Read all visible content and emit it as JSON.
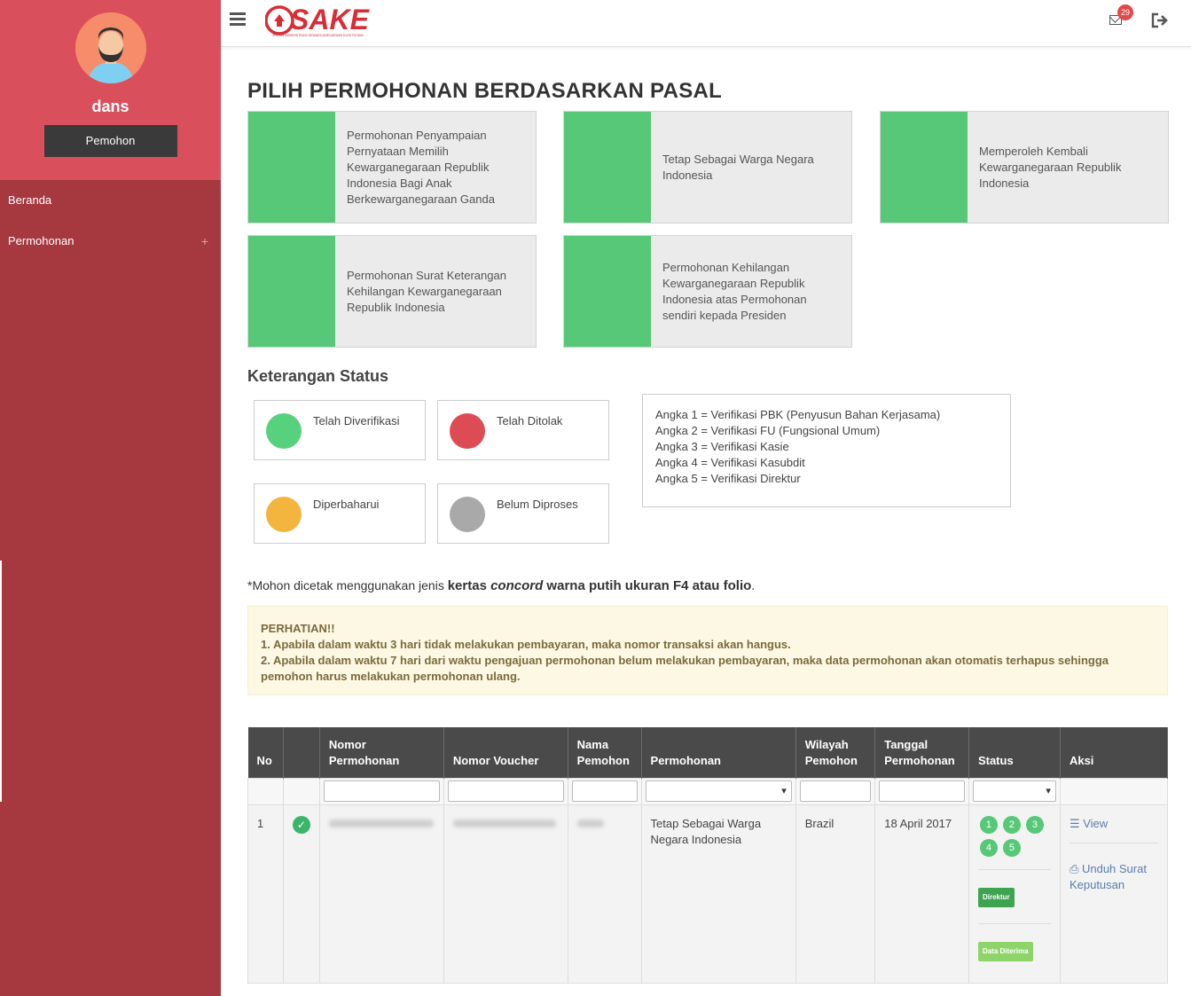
{
  "sidebar": {
    "username": "dans",
    "role": "Pemohon",
    "items": [
      {
        "label": "Beranda"
      },
      {
        "label": "Permohonan",
        "expand": "+"
      }
    ]
  },
  "topbar": {
    "logo_text": "SAKE",
    "logo_subtitle": "SISTEM ADMINISTRASI KEWARGANEGARAAN ELEKTRONIK",
    "notif_count": "29"
  },
  "main": {
    "title": "PILIH PERMOHONAN BERDASARKAN PASAL",
    "cards": [
      {
        "label": "Permohonan Penyampaian Pernyataan Memilih Kewarganegaraan Republik Indonesia Bagi Anak Berkewarganegaraan Ganda"
      },
      {
        "label": "Tetap Sebagai Warga Negara Indonesia"
      },
      {
        "label": "Memperoleh Kembali Kewarganegaraan Republik Indonesia"
      },
      {
        "label": "Permohonan Surat Keterangan Kehilangan Kewarganegaraan Republik Indonesia"
      },
      {
        "label": "Permohonan Kehilangan Kewarganegaraan Republik Indonesia atas Permohonan sendiri kepada Presiden"
      }
    ],
    "status_title": "Keterangan Status",
    "statuses": [
      {
        "label": "Telah Diverifikasi",
        "color": "#57d17e"
      },
      {
        "label": "Telah Ditolak",
        "color": "#dd4b55"
      },
      {
        "label": "Diperbaharui",
        "color": "#f4b53f"
      },
      {
        "label": "Belum Diproses",
        "color": "#a9a9a9"
      }
    ],
    "legend": [
      "Angka 1 = Verifikasi PBK (Penyusun Bahan Kerjasama)",
      "Angka 2 = Verifikasi FU (Fungsional Umum)",
      "Angka 3 = Verifikasi Kasie",
      "Angka 4 = Verifikasi Kasubdit",
      "Angka 5 = Verifikasi Direktur"
    ],
    "note": {
      "prefix": "*Mohon dicetak menggunakan jenis ",
      "bold1": "kertas ",
      "italic": "concord",
      "bold2": " warna putih ukuran F4 atau folio",
      "suffix": "."
    },
    "warning": {
      "title": "PERHATIAN!!",
      "line1": "1. Apabila dalam waktu 3 hari tidak melakukan pembayaran, maka nomor transaksi akan hangus.",
      "line2": "2. Apabila dalam waktu 7 hari dari waktu pengajuan permohonan belum melakukan pembayaran, maka data permohonan akan otomatis terhapus sehingga pemohon harus melakukan permohonan ulang."
    }
  },
  "table": {
    "headers": [
      "No",
      "",
      "Nomor Permohonan",
      "Nomor Voucher",
      "Nama Pemohon",
      "Permohonan",
      "Wilayah Pemohon",
      "Tanggal Permohonan",
      "Status",
      "Aksi"
    ],
    "rows": [
      {
        "no": "1",
        "permohonan": "Tetap Sebagai Warga Negara Indonesia",
        "wilayah": "Brazil",
        "tanggal": "18 April 2017",
        "steps": [
          "1",
          "2",
          "3",
          "4",
          "5"
        ],
        "tag1": "Direktur",
        "tag2": "Data Diterima",
        "action_view": "View",
        "action_download": "Unduh Surat Keputusan"
      }
    ]
  },
  "colors": {
    "sidebar": "#a6383f",
    "profile": "#d94f5c",
    "card_accent": "#57c878",
    "header": "#4a4a4a"
  }
}
